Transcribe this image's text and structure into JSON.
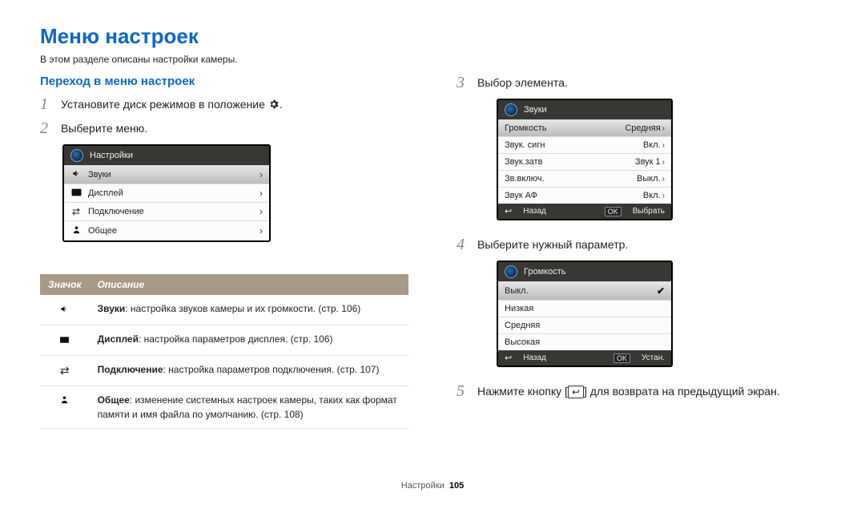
{
  "page": {
    "title": "Меню настроек",
    "intro": "В этом разделе описаны настройки камеры.",
    "footer_section": "Настройки",
    "footer_page": "105"
  },
  "left": {
    "section_title": "Переход в меню настроек",
    "step1_pre": "Установите диск режимов в положение ",
    "step1_post": ".",
    "step2": "Выберите меню.",
    "panel1": {
      "header": "Настройки",
      "rows": [
        {
          "icon": "speaker",
          "label": "Звуки"
        },
        {
          "icon": "display",
          "label": "Дисплей"
        },
        {
          "icon": "conn",
          "label": "Подключение"
        },
        {
          "icon": "person",
          "label": "Общее"
        }
      ]
    },
    "table": {
      "head_icon": "Значок",
      "head_desc": "Описание",
      "rows": [
        {
          "icon": "speaker",
          "bold": "Звуки",
          "rest": ": настройка звуков камеры и их громкости. (стр. 106)"
        },
        {
          "icon": "display",
          "bold": "Дисплей",
          "rest": ": настройка параметров дисплея. (стр. 106)"
        },
        {
          "icon": "conn",
          "bold": "Подключение",
          "rest": ": настройка параметров подключения. (стр. 107)"
        },
        {
          "icon": "person",
          "bold": "Общее",
          "rest": ": изменение системных настроек камеры, таких как формат памяти и имя файла по умолчанию. (стр. 108)"
        }
      ]
    }
  },
  "right": {
    "step3": "Выбор элемента.",
    "panel2": {
      "header": "Звуки",
      "rows": [
        {
          "label": "Громкость",
          "value": "Средняя",
          "sel": true
        },
        {
          "label": "Звук. сигн",
          "value": "Вкл."
        },
        {
          "label": "Звук.затв",
          "value": "Звук 1"
        },
        {
          "label": "Зв.включ.",
          "value": "Выкл."
        },
        {
          "label": "Звук АФ",
          "value": "Вкл."
        }
      ],
      "footer_back": "Назад",
      "footer_ok": "Выбрать",
      "ok_label": "OK"
    },
    "step4": "Выберите нужный параметр.",
    "panel3": {
      "header": "Громкость",
      "rows": [
        {
          "label": "Выкл.",
          "check": true,
          "sel": true
        },
        {
          "label": "Низкая"
        },
        {
          "label": "Средняя"
        },
        {
          "label": "Высокая"
        }
      ],
      "footer_back": "Назад",
      "footer_ok": "Устан.",
      "ok_label": "OK"
    },
    "step5_pre": "Нажмите кнопку [",
    "step5_post": "] для возврата на предыдущий экран."
  },
  "icons": {
    "gear_name": "gear-icon",
    "return_name": "return-icon"
  }
}
